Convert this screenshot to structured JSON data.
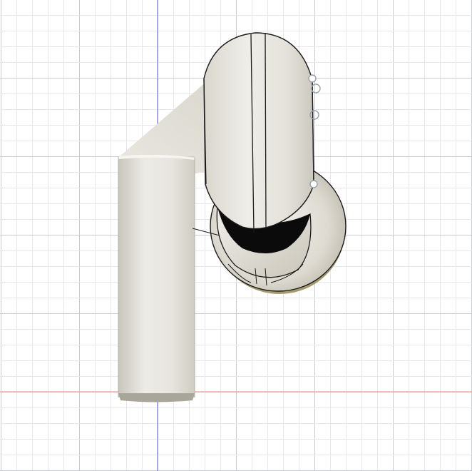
{
  "viewport": {
    "view": "front",
    "grid": true,
    "background_color": "#ffffff",
    "grid_minor_color": "#e6e6ec",
    "grid_major_color": "#c9cad2",
    "axis_colors": {
      "vertical_axis": "#7b7bf0",
      "horizontal_axis": "#f2a0a0"
    }
  },
  "model": {
    "body_color": "#e8e6df",
    "shadow_color": "#b9b6ab",
    "edge_color": "#1b1b1b",
    "cavity_color": "#0b0b0b",
    "rim_accent_color": "#a49a6e",
    "sketch_point_color": "#9aa0aa",
    "sketch_points_visible": 4
  }
}
